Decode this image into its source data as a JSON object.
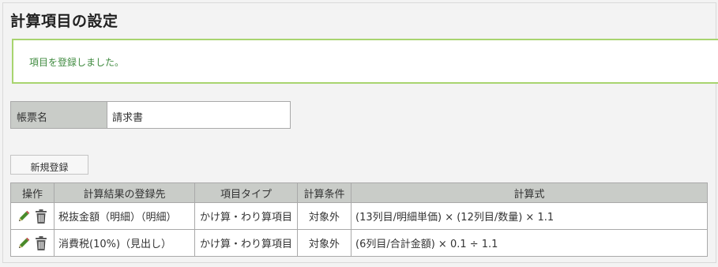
{
  "page": {
    "title": "計算項目の設定"
  },
  "alert": {
    "message": "項目を登録しました。",
    "border_color": "#a8d46f",
    "text_color": "#3f8a3f"
  },
  "form": {
    "label": "帳票名",
    "value": "請求書"
  },
  "toolbar": {
    "new_label": "新規登録"
  },
  "table": {
    "headers": [
      "操作",
      "計算結果の登録先",
      "項目タイプ",
      "計算条件",
      "計算式"
    ],
    "rows": [
      {
        "target": "税抜金額（明細）（明細）",
        "type": "かけ算・わり算項目",
        "condition": "対象外",
        "formula": "(13列目/明細単価) × (12列目/数量) × 1.1",
        "icons": [
          "pencil-icon",
          "trash-icon"
        ]
      },
      {
        "target": "消費税(10%)（見出し）",
        "type": "かけ算・わり算項目",
        "condition": "対象外",
        "formula": "(6列目/合計金額) × 0.1 ÷ 1.1",
        "icons": [
          "pencil-icon",
          "trash-icon"
        ]
      }
    ]
  },
  "colors": {
    "header_bg": "#c9ccc8",
    "pencil": "#4a8a2a",
    "trash": "#5a5a5a"
  }
}
